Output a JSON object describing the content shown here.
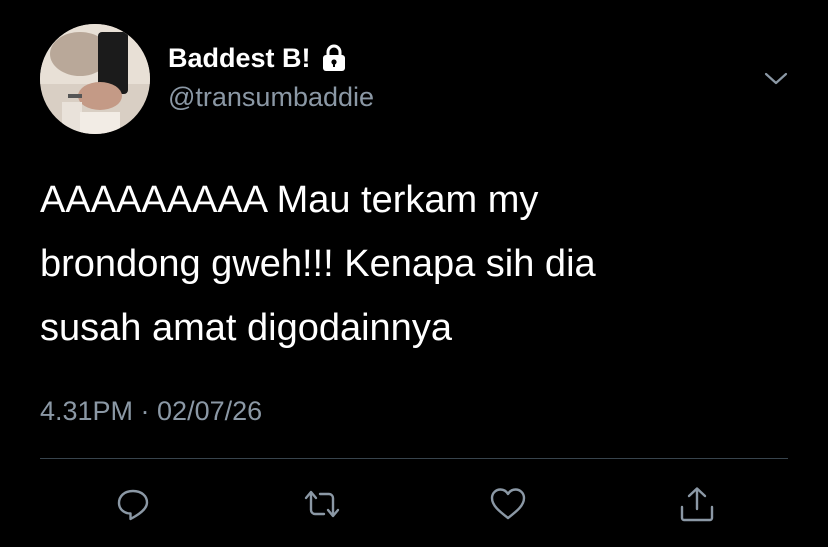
{
  "user": {
    "display_name": "Baddest B!",
    "handle": "@transumbaddie",
    "protected_icon": "lock-icon"
  },
  "tweet": {
    "lines": [
      "AAAAAAAAA Mau terkam my",
      "brondong gweh!!! Kenapa sih dia",
      "susah amat digodainnya"
    ],
    "timestamp": "4.31PM · 02/07/26"
  },
  "actions": {
    "reply_icon": "reply-icon",
    "retweet_icon": "retweet-icon",
    "like_icon": "heart-icon",
    "share_icon": "share-icon"
  },
  "colors": {
    "background": "#000000",
    "text": "#ffffff",
    "secondary_text": "#8b98a5",
    "divider": "#38444d"
  }
}
